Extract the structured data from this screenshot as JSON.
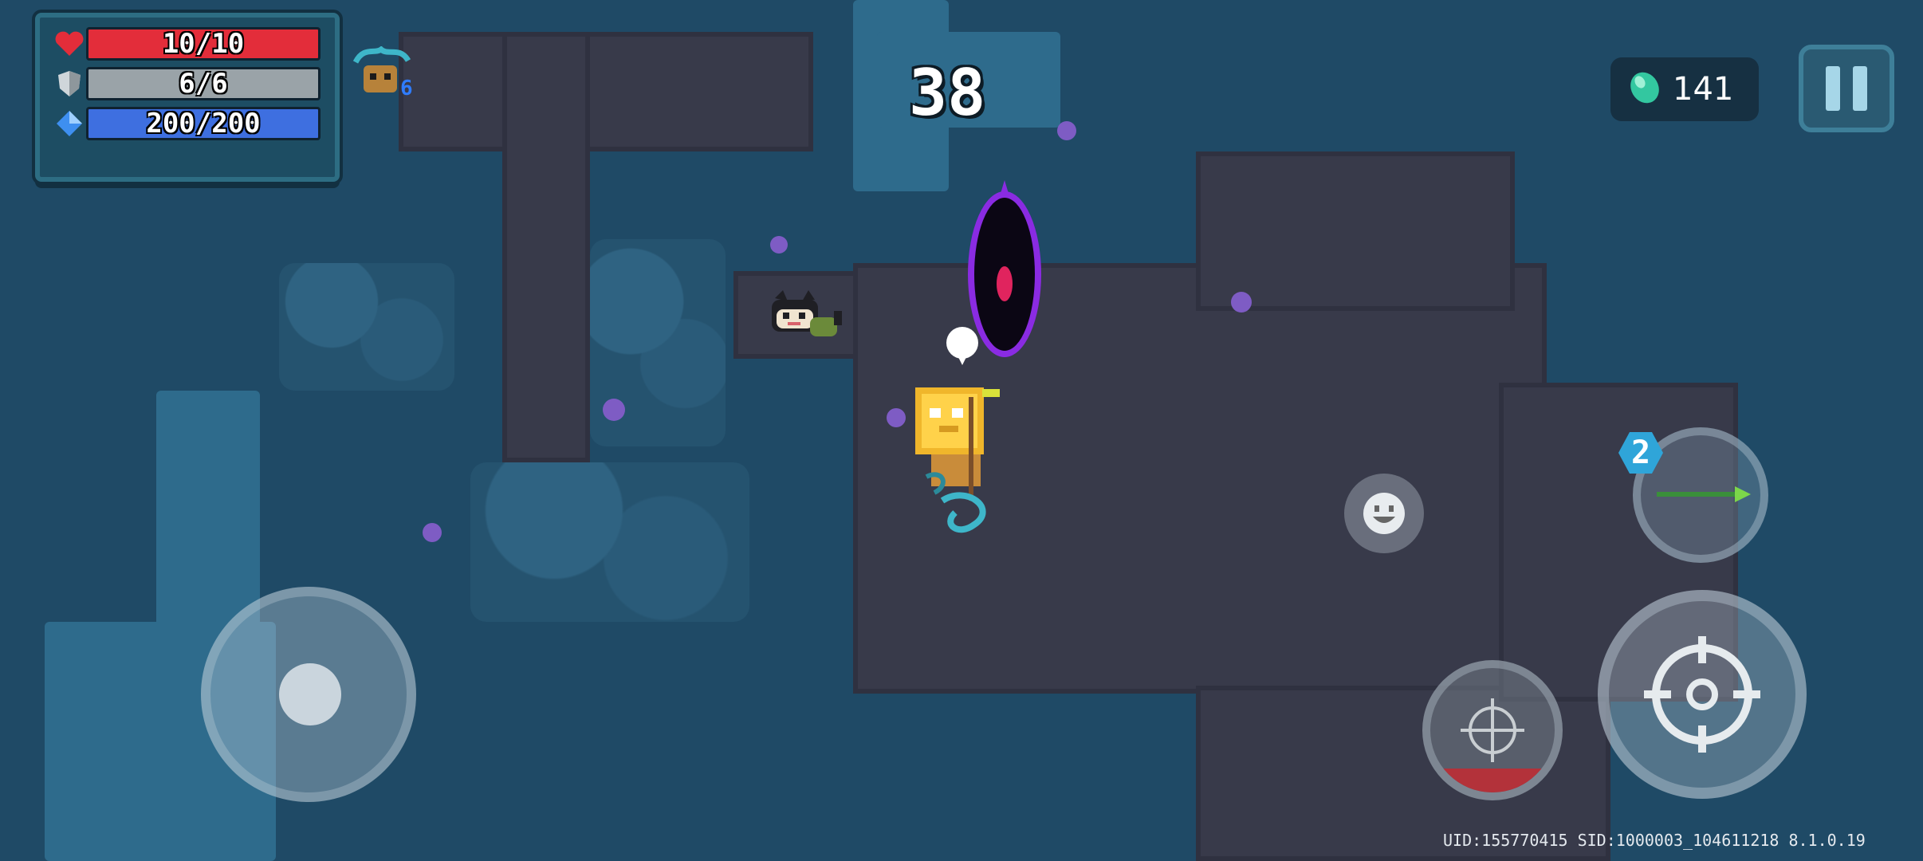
{
  "hud": {
    "hp": {
      "text": "10/10",
      "fraction": 1.0,
      "color": "#e32d3a"
    },
    "armor": {
      "text": "6/6",
      "fraction": 1.0,
      "color": "#9aa3a8"
    },
    "energy": {
      "text": "200/200",
      "fraction": 1.0,
      "color": "#3e6fe0"
    }
  },
  "buff": {
    "icon": "vine-creature-buff-icon",
    "count": "6"
  },
  "timer": {
    "value": "38"
  },
  "gems": {
    "icon": "gem-icon",
    "value": "141"
  },
  "controls": {
    "pause_icon": "pause-icon",
    "emote_icon": "smiley-face-icon",
    "weapon_count": "2",
    "weapon_icon": "green-spear-icon",
    "attack_icon": "crosshair-icon",
    "skill_icon": "crosshair-skill-icon"
  },
  "footer": {
    "ids": "UID:155770415 SID:1000003_104611218 8.1.0.19"
  },
  "colors": {
    "hp_red": "#e32d3a",
    "armor_gray": "#9aa3a8",
    "energy_blue": "#3e6fe0",
    "portal_purple": "#8a2be2",
    "portal_core": "#e0245e",
    "ground": "#383a4a",
    "water": "#2e6b8c"
  }
}
